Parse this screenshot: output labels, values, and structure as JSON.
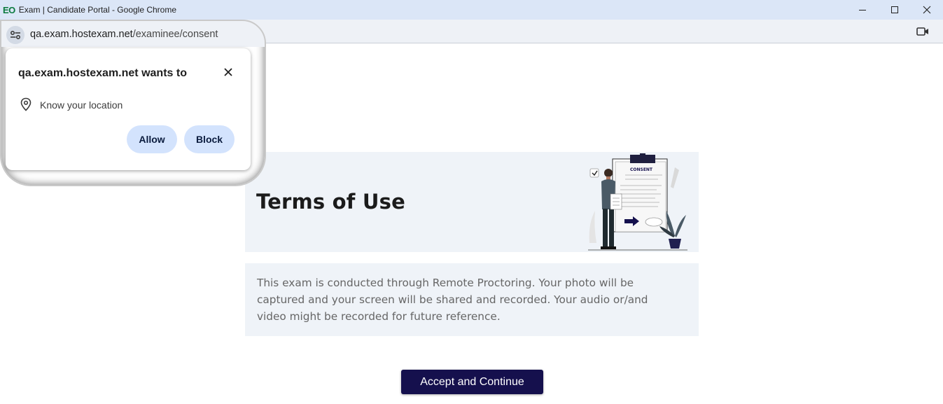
{
  "window": {
    "logo": "EO",
    "title": "Exam | Candidate Portal - Google Chrome"
  },
  "addressbar": {
    "host": "qa.exam.hostexam.net",
    "path": "/examinee/consent"
  },
  "permission_prompt": {
    "title": "qa.exam.hostexam.net wants to",
    "request": "Know your location",
    "allow_label": "Allow",
    "block_label": "Block"
  },
  "page": {
    "title": "Terms of Use",
    "illustration_label": "CONSENT",
    "notice": "This exam is conducted through Remote Proctoring. Your photo will be captured and your screen will be shared and recorded. Your audio or/and video might be recorded for future reference.",
    "accept_label": "Accept and Continue"
  },
  "colors": {
    "primary_button": "#15104d",
    "panel_background": "#eff3f8",
    "permission_button": "#d3e3fd"
  }
}
